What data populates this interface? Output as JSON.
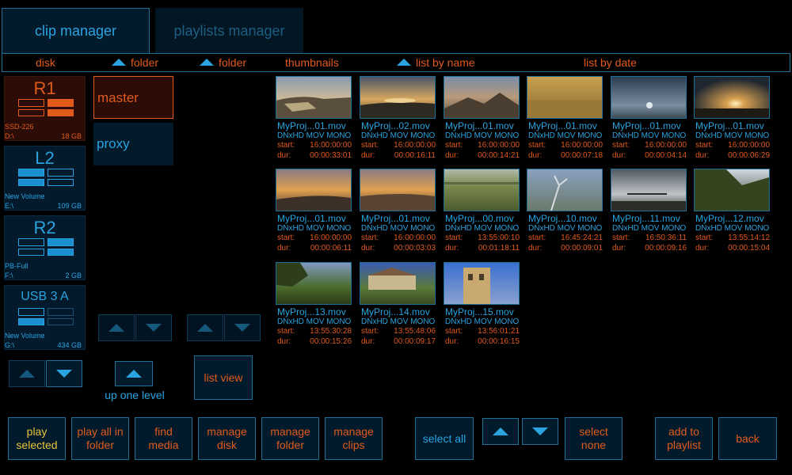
{
  "tabs": {
    "clip_manager": "clip manager",
    "playlists_manager": "playlists manager"
  },
  "headers": {
    "disk": "disk",
    "folder1": "folder",
    "folder2": "folder",
    "thumbnails": "thumbnails",
    "list_by_name": "list by name",
    "list_by_date": "list by date"
  },
  "disks": [
    {
      "name": "R1",
      "volume": "SSD-226",
      "path": "D:\\",
      "size": "18 GB"
    },
    {
      "name": "L2",
      "volume": "New Volume",
      "path": "E:\\",
      "size": "109 GB"
    },
    {
      "name": "R2",
      "volume": "PB-Full",
      "path": "F:\\",
      "size": "2 GB"
    },
    {
      "name": "USB 3 A",
      "volume": "New Volume",
      "path": "G:\\",
      "size": "434 GB"
    }
  ],
  "folders": [
    "master",
    "proxy"
  ],
  "controls": {
    "up_one_level": "up one level",
    "list_view": "list view"
  },
  "clip_labels": {
    "start": "start:",
    "dur": "dur:"
  },
  "clips": [
    {
      "name": "MyProj...01.mov",
      "format": "DNxHD MOV MONO",
      "start": "16:00:00:00",
      "dur": "00:00:33:01"
    },
    {
      "name": "MyProj...02.mov",
      "format": "DNxHD MOV MONO",
      "start": "16:00:00:00",
      "dur": "00:00:16:11"
    },
    {
      "name": "MyProj...01.mov",
      "format": "DNxHD MOV MONO",
      "start": "16:00:00:00",
      "dur": "00:00:14:21"
    },
    {
      "name": "MyProj...01.mov",
      "format": "DNxHD MOV MONO",
      "start": "16:00:00:00",
      "dur": "00:00:07:18"
    },
    {
      "name": "MyProj...01.mov",
      "format": "DNxHD MOV MONO",
      "start": "16:00:00:00",
      "dur": "00:00:04:14"
    },
    {
      "name": "MyProj...01.mov",
      "format": "DNxHD MOV MONO",
      "start": "16:00:00:00",
      "dur": "00:00:06:29"
    },
    {
      "name": "MyProj...01.mov",
      "format": "DNxHD MOV MONO",
      "start": "16:00:00:00",
      "dur": "00:00:06:11"
    },
    {
      "name": "MyProj...01.mov",
      "format": "DNxHD MOV MONO",
      "start": "16:00:00:00",
      "dur": "00:00:03:03"
    },
    {
      "name": "MyProj...00.mov",
      "format": "DNxHD MOV MONO",
      "start": "13:55:00:10",
      "dur": "00:01:18:11"
    },
    {
      "name": "MyProj...10.mov",
      "format": "DNxHD MOV MONO",
      "start": "16:45:24:21",
      "dur": "00:00:09:01"
    },
    {
      "name": "MyProj...11.mov",
      "format": "DNxHD MOV MONO",
      "start": "16:50:36:11",
      "dur": "00:00:09:16"
    },
    {
      "name": "MyProj...12.mov",
      "format": "DNxHD MOV MONO",
      "start": "13:55:14:12",
      "dur": "00:00:15:04"
    },
    {
      "name": "MyProj...13.mov",
      "format": "DNxHD MOV MONO",
      "start": "13:55:30:28",
      "dur": "00:00:15:26"
    },
    {
      "name": "MyProj...14.mov",
      "format": "DNxHD MOV MONO",
      "start": "13:55:48:06",
      "dur": "00:00:09:17"
    },
    {
      "name": "MyProj...15.mov",
      "format": "DNxHD MOV MONO",
      "start": "13:56:01:21",
      "dur": "00:00:16:15"
    }
  ],
  "bottom": {
    "play_selected": [
      "play",
      "selected"
    ],
    "play_all": [
      "play all in",
      "folder"
    ],
    "find_media": [
      "find",
      "media"
    ],
    "manage_disk": [
      "manage",
      "disk"
    ],
    "manage_folder": [
      "manage",
      "folder"
    ],
    "manage_clips": [
      "manage",
      "clips"
    ],
    "select_all": "select all",
    "select_none": [
      "select",
      "none"
    ],
    "add_to_playlist": [
      "add to",
      "playlist"
    ],
    "back": "back"
  },
  "colors": {
    "accent_blue": "#2aa3e0",
    "accent_orange": "#e05a1c",
    "highlight_yellow": "#e8c33a",
    "panel_bg": "#021b2c"
  }
}
